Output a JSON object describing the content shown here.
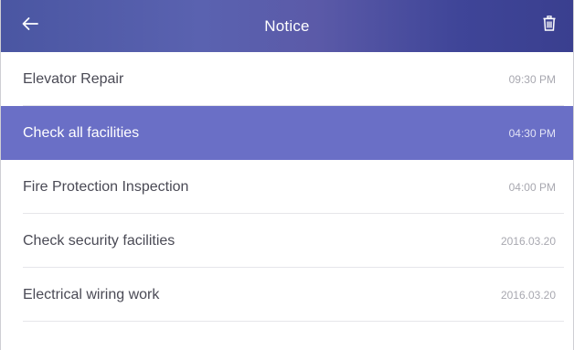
{
  "header": {
    "title": "Notice",
    "back_icon": "arrow-left-icon",
    "delete_icon": "trash-icon"
  },
  "colors": {
    "header_bg": "#4a56a2",
    "selected_row_bg": "#6a6fc6",
    "text": "#4a4a55",
    "time_text": "#a8a8b0"
  },
  "notices": [
    {
      "title": "Elevator Repair",
      "time": "09:30 PM",
      "selected": false
    },
    {
      "title": "Check all facilities",
      "time": "04:30 PM",
      "selected": true
    },
    {
      "title": "Fire Protection Inspection",
      "time": "04:00 PM",
      "selected": false
    },
    {
      "title": "Check security facilities",
      "time": "2016.03.20",
      "selected": false
    },
    {
      "title": "Electrical wiring work",
      "time": "2016.03.20",
      "selected": false
    }
  ]
}
